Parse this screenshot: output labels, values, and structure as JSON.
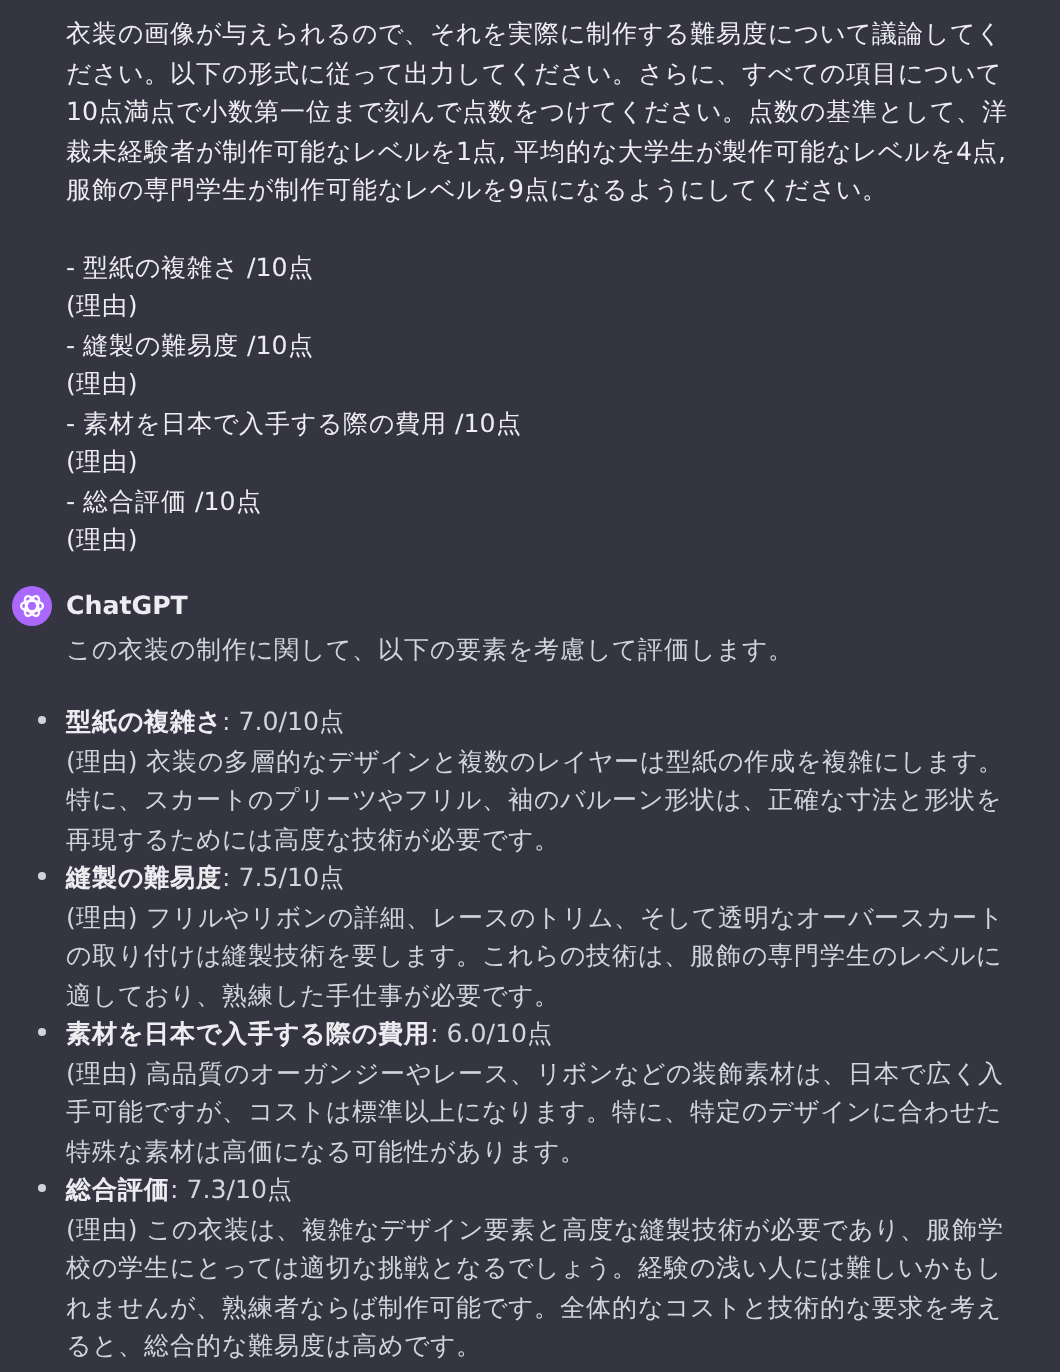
{
  "user_message": {
    "paragraph": "衣装の画像が与えられるので、それを実際に制作する難易度について議論してください。以下の形式に従って出力してください。さらに、すべての項目について10点満点で小数第一位まで刻んで点数をつけてください。点数の基準として、洋裁未経験者が制作可能なレベルを1点, 平均的な大学生が製作可能なレベルを4点, 服飾の専門学生が制作可能なレベルを9点になるようにしてください。",
    "lines": [
      "- 型紙の複雑さ /10点",
      "(理由)",
      "- 縫製の難易度 /10点",
      "(理由)",
      "- 素材を日本で入手する際の費用 /10点",
      "(理由)",
      "- 総合評価 /10点",
      "(理由)"
    ]
  },
  "assistant": {
    "name": "ChatGPT",
    "intro": "この衣装の制作に関して、以下の要素を考慮して評価します。",
    "items": [
      {
        "heading": "**型紙の複雑さ**: 7.0/10点",
        "reason": "(理由) 衣装の多層的なデザインと複数のレイヤーは型紙の作成を複雑にします。特に、スカートのプリーツやフリル、袖のバルーン形状は、正確な寸法と形状を再現するためには高度な技術が必要です。"
      },
      {
        "heading": "**縫製の難易度**: 7.5/10点",
        "reason": "(理由) フリルやリボンの詳細、レースのトリム、そして透明なオーバースカートの取り付けは縫製技術を要します。これらの技術は、服飾の専門学生のレベルに適しており、熟練した手仕事が必要です。"
      },
      {
        "heading": "**素材を日本で入手する際の費用**: 6.0/10点",
        "reason": "(理由) 高品質のオーガンジーやレース、リボンなどの装飾素材は、日本で広く入手可能ですが、コストは標準以上になります。特に、特定のデザインに合わせた特殊な素材は高価になる可能性があります。"
      },
      {
        "heading": "**総合評価**: 7.3/10点",
        "reason": "(理由) この衣装は、複雑なデザイン要素と高度な縫製技術が必要であり、服飾学校の学生にとっては適切な挑戦となるでしょう。経験の浅い人には難しいかもしれませんが、熟練者ならば制作可能です。全体的なコストと技術的な要求を考えると、総合的な難易度は高めです。"
      }
    ]
  }
}
